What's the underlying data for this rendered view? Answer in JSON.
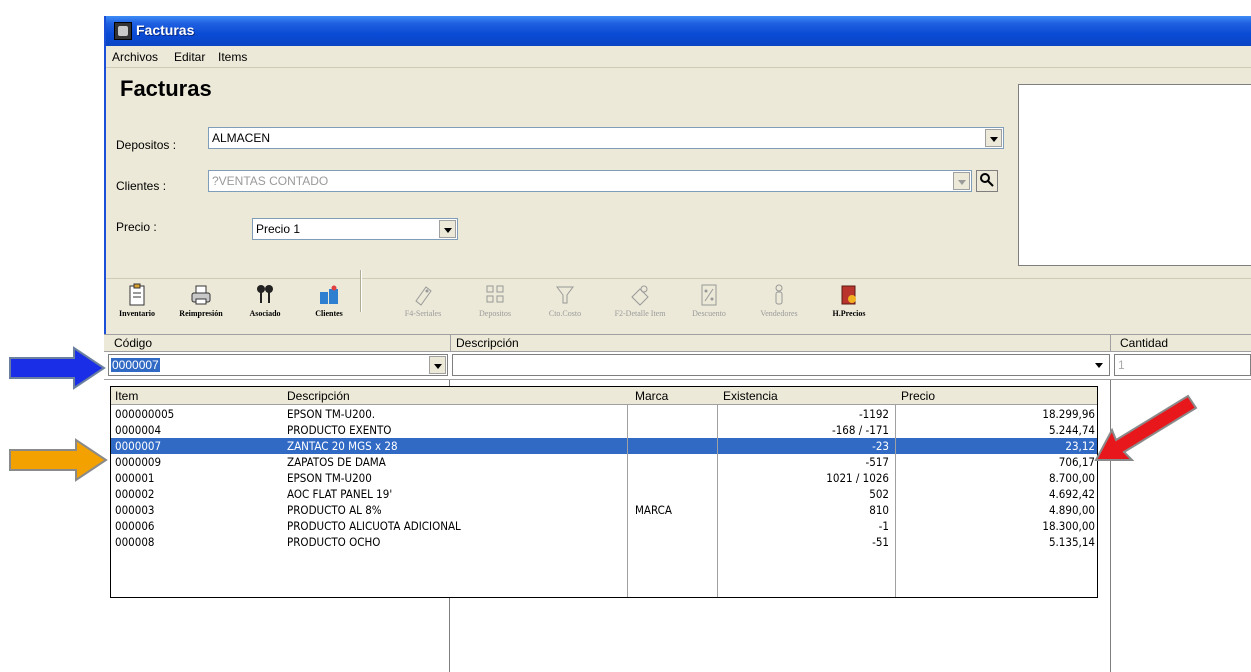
{
  "window": {
    "title": "Facturas"
  },
  "menu": [
    "Archivos",
    "Editar",
    "Items"
  ],
  "form": {
    "heading": "Facturas",
    "depositos_label": "Depositos :",
    "depositos_value": "ALMACEN",
    "clientes_label": "Clientes :",
    "clientes_value": "?VENTAS CONTADO",
    "precio_label": "Precio :",
    "precio_value": "Precio 1"
  },
  "toolbar": [
    {
      "label": "Inventario",
      "icon": "clipboard-icon",
      "enabled": true
    },
    {
      "label": "Reimpresión",
      "icon": "printer-icon",
      "enabled": true
    },
    {
      "label": "Asociado",
      "icon": "pins-icon",
      "enabled": true
    },
    {
      "label": "Clientes",
      "icon": "clients-icon",
      "enabled": true
    },
    {
      "label": "F4-Seriales",
      "icon": "tag-icon",
      "enabled": false
    },
    {
      "label": "Depositos",
      "icon": "depots-icon",
      "enabled": false
    },
    {
      "label": "Cto.Costo",
      "icon": "funnel-icon",
      "enabled": false
    },
    {
      "label": "F2-Detalle Item",
      "icon": "detail-icon",
      "enabled": false
    },
    {
      "label": "Descuento",
      "icon": "percent-icon",
      "enabled": false
    },
    {
      "label": "Vendedores",
      "icon": "person-icon",
      "enabled": false
    },
    {
      "label": "H.Precios",
      "icon": "book-icon",
      "enabled": true
    }
  ],
  "grid": {
    "headers": {
      "codigo": "Código",
      "descripcion": "Descripción",
      "cantidad": "Cantidad"
    },
    "codigo_value": "0000007",
    "cantidad_value": "1"
  },
  "lookup": {
    "headers": {
      "item": "Item",
      "descripcion": "Descripción",
      "marca": "Marca",
      "existencia": "Existencia",
      "precio": "Precio"
    },
    "rows": [
      {
        "item": "000000005",
        "descripcion": "EPSON TM-U200.",
        "marca": "",
        "existencia": "-1192",
        "precio": "18.299,96"
      },
      {
        "item": "0000004",
        "descripcion": "PRODUCTO EXENTO",
        "marca": "",
        "existencia": "-168 / -171",
        "precio": "5.244,74"
      },
      {
        "item": "0000007",
        "descripcion": "ZANTAC 20 MGS x 28",
        "marca": "",
        "existencia": "-23",
        "precio": "23,12"
      },
      {
        "item": "0000009",
        "descripcion": "ZAPATOS DE DAMA",
        "marca": "",
        "existencia": "-517",
        "precio": "706,17"
      },
      {
        "item": "000001",
        "descripcion": "EPSON TM-U200",
        "marca": "",
        "existencia": "1021 / 1026",
        "precio": "8.700,00"
      },
      {
        "item": "000002",
        "descripcion": "AOC FLAT PANEL 19'",
        "marca": "",
        "existencia": "502",
        "precio": "4.692,42"
      },
      {
        "item": "000003",
        "descripcion": "PRODUCTO AL 8%",
        "marca": "MARCA",
        "existencia": "810",
        "precio": "4.890,00"
      },
      {
        "item": "000006",
        "descripcion": "PRODUCTO ALICUOTA ADICIONAL",
        "marca": "",
        "existencia": "-1",
        "precio": "18.300,00"
      },
      {
        "item": "000008",
        "descripcion": "PRODUCTO OCHO",
        "marca": "",
        "existencia": "-51",
        "precio": "5.135,14"
      }
    ],
    "selected_index": 2
  },
  "annotations": {
    "blue": "#1a2ee8",
    "orange": "#f2a100",
    "red": "#e8171c"
  }
}
